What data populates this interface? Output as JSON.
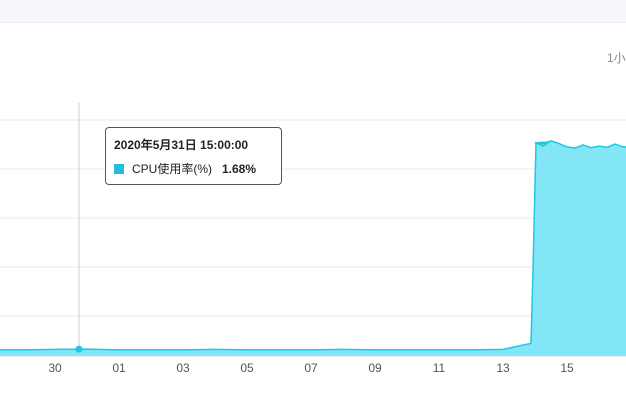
{
  "header": {
    "range_label": "1小"
  },
  "tooltip": {
    "timestamp": "2020年5月31日 15:00:00",
    "series_name": "CPU使用率(%)",
    "value": "1.68%"
  },
  "colors": {
    "series_fill": "#82e6f7",
    "series_line": "#1fc8e3",
    "grid": "#e9e9e9",
    "crosshair": "#cccccc",
    "swatch": "#1fbfdc"
  },
  "chart_data": {
    "type": "area",
    "series": [
      {
        "name": "CPU使用率(%)",
        "x": [
          "2020-05-29",
          "2020-05-30",
          "2020-05-31",
          "2020-06-01",
          "2020-06-02",
          "2020-06-03",
          "2020-06-04",
          "2020-06-05",
          "2020-06-06",
          "2020-06-07",
          "2020-06-08",
          "2020-06-09",
          "2020-06-10",
          "2020-06-11",
          "2020-06-12",
          "2020-06-13",
          "2020-06-14",
          "2020-06-15",
          "2020-06-16",
          "2020-06-17"
        ],
        "values": [
          1.5,
          1.6,
          1.68,
          1.5,
          1.5,
          1.5,
          1.6,
          1.5,
          1.5,
          1.5,
          1.6,
          1.5,
          1.5,
          1.5,
          1.5,
          1.6,
          52.0,
          51.0,
          51.2,
          51.0
        ]
      }
    ],
    "x_tick_labels": [
      "30",
      "01",
      "03",
      "05",
      "07",
      "09",
      "11",
      "13",
      "15"
    ],
    "grid": true,
    "legend": "none"
  }
}
